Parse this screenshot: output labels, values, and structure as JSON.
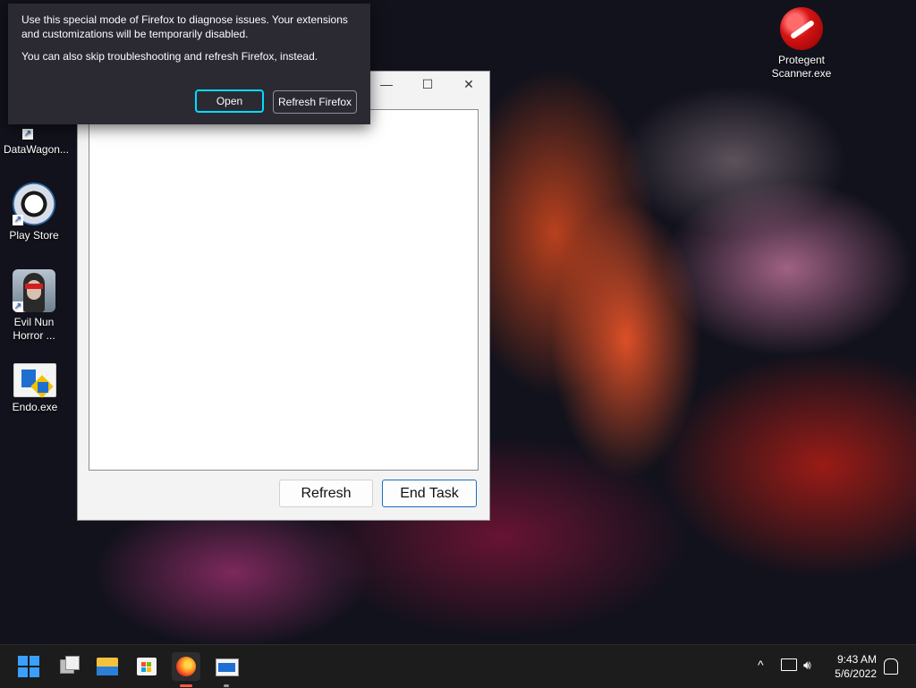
{
  "desktop": {
    "icons": [
      {
        "label": "DataWagon..."
      },
      {
        "label": "Play Store"
      },
      {
        "label": "Evil Nun Horror ..."
      },
      {
        "label": "Endo.exe"
      },
      {
        "label": "Protegent Scanner.exe"
      }
    ]
  },
  "ff_dialog": {
    "message1": "Use this special mode of Firefox to diagnose issues. Your extensions and customizations will be temporarily disabled.",
    "message2": "You can also skip troubleshooting and refresh Firefox, instead.",
    "open_label": "Open",
    "refresh_label": "Refresh Firefox"
  },
  "task_window": {
    "minimize_glyph": "—",
    "maximize_glyph": "☐",
    "close_glyph": "✕",
    "refresh_label": "Refresh",
    "end_task_label": "End Task"
  },
  "taskbar": {
    "apps": [
      {
        "icon": "windows-start-icon"
      },
      {
        "icon": "task-view-icon"
      },
      {
        "icon": "file-explorer-icon"
      },
      {
        "icon": "microsoft-store-icon"
      },
      {
        "icon": "firefox-icon"
      },
      {
        "icon": "app-window-icon"
      }
    ],
    "tray": {
      "chevron": "^",
      "time": "9:43 AM",
      "date": "5/6/2022"
    }
  },
  "colors": {
    "accent": "#0078d4",
    "dialog_bg": "#2b2a33",
    "taskbar_bg": "#1c1c1c"
  }
}
